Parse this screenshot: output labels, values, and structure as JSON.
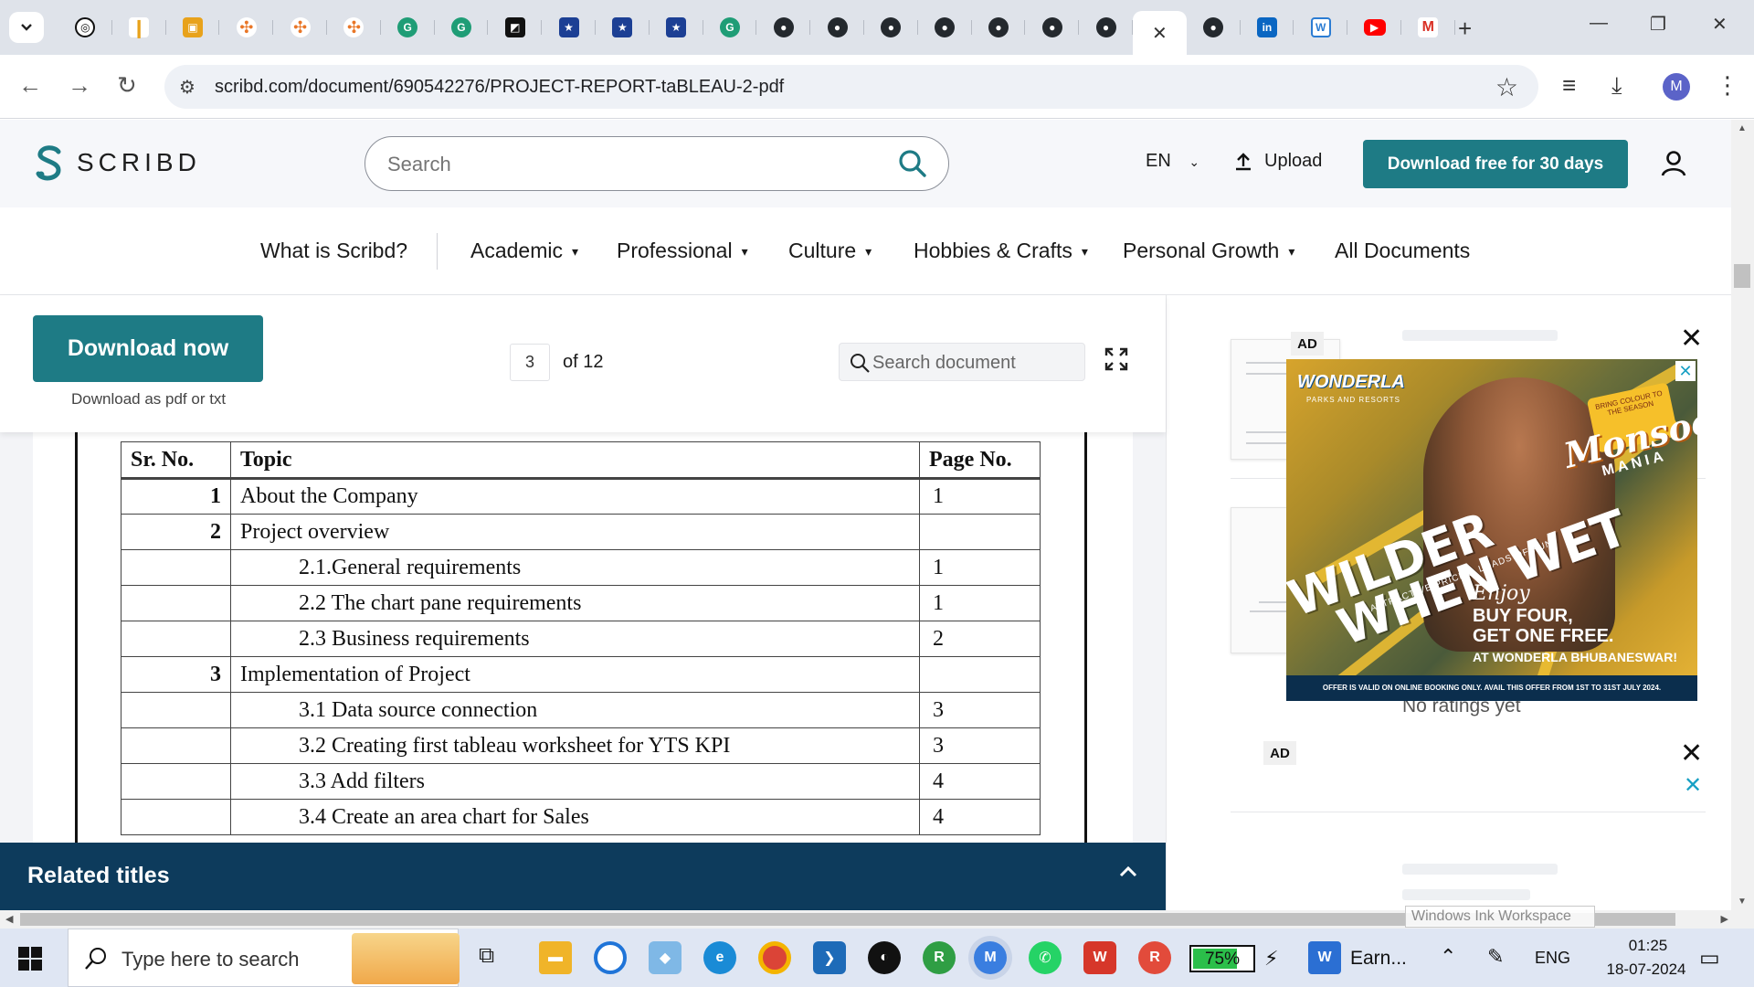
{
  "browser": {
    "url": "scribd.com/document/690542276/PROJECT-REPORT-taBLEAU-2-pdf",
    "profile_initial": "M",
    "new_tab_label": "+"
  },
  "header": {
    "logo_text": "SCRIBD",
    "search_placeholder": "Search",
    "language": "EN",
    "upload_label": "Upload",
    "download_free_label": "Download free for 30 days"
  },
  "categories": [
    {
      "label": "What is Scribd?"
    },
    {
      "label": "Academic"
    },
    {
      "label": "Professional"
    },
    {
      "label": "Culture"
    },
    {
      "label": "Hobbies & Crafts"
    },
    {
      "label": "Personal Growth"
    },
    {
      "label": "All Documents"
    }
  ],
  "doc_toolbar": {
    "download_now_label": "Download now",
    "download_sub": "Download as pdf or txt",
    "current_page": "3",
    "page_of": "of 12",
    "search_placeholder": "Search document"
  },
  "toc": {
    "headers": [
      "Sr. No.",
      "Topic",
      "Page No."
    ],
    "rows": [
      {
        "sr": "1",
        "topic": "About the Company",
        "page": "1",
        "sub": false
      },
      {
        "sr": "2",
        "topic": "Project overview",
        "page": "",
        "sub": false
      },
      {
        "sr": "",
        "topic": "2.1.General requirements",
        "page": "1",
        "sub": true
      },
      {
        "sr": "",
        "topic": "2.2 The chart pane requirements",
        "page": "1",
        "sub": true
      },
      {
        "sr": "",
        "topic": "2.3 Business requirements",
        "page": "2",
        "sub": true
      },
      {
        "sr": "3",
        "topic": "Implementation of Project",
        "page": "",
        "sub": false
      },
      {
        "sr": "",
        "topic": "3.1 Data source connection",
        "page": "3",
        "sub": true
      },
      {
        "sr": "",
        "topic": "3.2 Creating first tableau worksheet for YTS KPI",
        "page": "3",
        "sub": true
      },
      {
        "sr": "",
        "topic": "3.3 Add filters",
        "page": "4",
        "sub": true
      },
      {
        "sr": "",
        "topic": "3.4 Create an area chart for Sales",
        "page": "4",
        "sub": true
      }
    ]
  },
  "related": {
    "title": "Related titles"
  },
  "sidebar": {
    "ad_badge": "AD",
    "no_ratings": "No ratings yet"
  },
  "ad": {
    "brand": "WONDERLA",
    "brand_sub": "PARKS AND RESORTS",
    "season": "BRING COLOUR TO THE SEASON",
    "monsoon": "Monsoon",
    "mania": "MANIA",
    "headline_1": "WILDER",
    "headline_2": "WHEN WET",
    "tagline": "ATTRACTIVE PRICES, LOADS OF FUN",
    "enjoy": "Enjoy",
    "offer_1": "BUY FOUR,",
    "offer_2": "GET ONE FREE.",
    "offer_3": "AT WONDERLA BHUBANESWAR!",
    "footer": "OFFER IS VALID ON ONLINE BOOKING ONLY. AVAIL THIS OFFER FROM 1ST TO 31ST JULY 2024."
  },
  "overlay": {
    "ink_workspace": "Windows Ink Workspace"
  },
  "taskbar": {
    "search_placeholder": "Type here to search",
    "battery_percent": "75%",
    "battery_level": 0.75,
    "active_window": "Earn...",
    "language": "ENG",
    "time": "01:25",
    "date": "18-07-2024"
  },
  "colors": {
    "brand_teal": "#1e7b85",
    "related_bar": "#0d3b5c"
  }
}
